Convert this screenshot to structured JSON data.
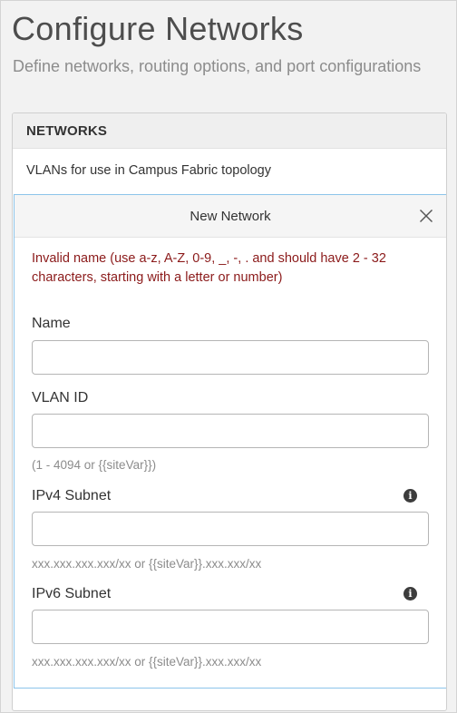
{
  "page": {
    "title": "Configure Networks",
    "subtitle": "Define networks, routing options, and port configurations"
  },
  "networks": {
    "header": "NETWORKS",
    "description": "VLANs for use in Campus Fabric topology"
  },
  "new_network": {
    "title": "New Network",
    "close_icon": "close-icon",
    "error": "Invalid name (use a-z, A-Z, 0-9, _, -, . and should have 2 - 32 characters, starting with a letter or number)",
    "fields": {
      "name": {
        "label": "Name",
        "value": "",
        "placeholder": ""
      },
      "vlan_id": {
        "label": "VLAN ID",
        "value": "",
        "placeholder": "",
        "hint": "(1 - 4094 or {{siteVar}})"
      },
      "ipv4": {
        "label": "IPv4 Subnet",
        "value": "",
        "placeholder": "",
        "hint": "xxx.xxx.xxx.xxx/xx or {{siteVar}}.xxx.xxx/xx",
        "info_icon": "info-icon",
        "info_glyph": "i"
      },
      "ipv6": {
        "label": "IPv6 Subnet",
        "value": "",
        "placeholder": "",
        "hint": "xxx.xxx.xxx.xxx/xx or {{siteVar}}.xxx.xxx/xx",
        "info_icon": "info-icon",
        "info_glyph": "i"
      }
    }
  },
  "colors": {
    "error": "#8b1a1a",
    "panel_border": "#8cc4ea",
    "hint": "#8c8c8c"
  }
}
